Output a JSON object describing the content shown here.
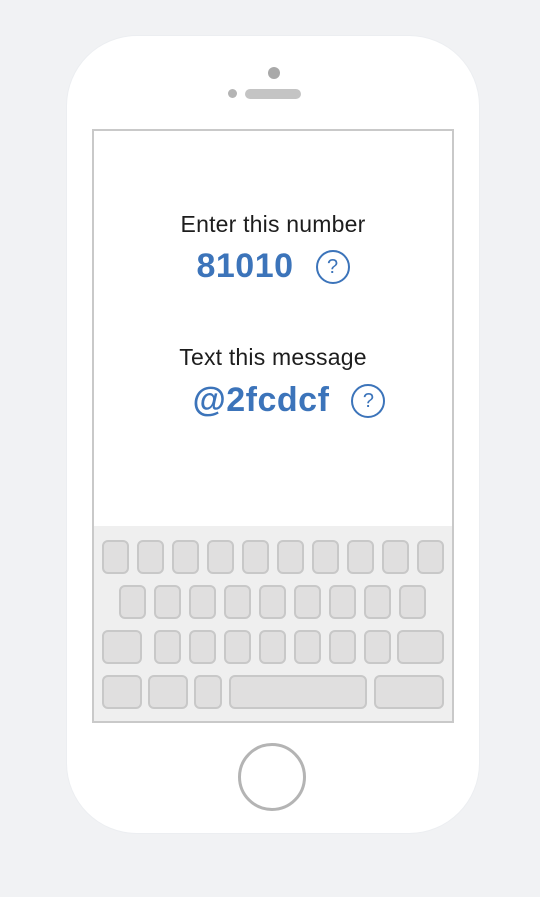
{
  "number_prompt": {
    "label": "Enter this number",
    "value": "81010",
    "help_icon": "?"
  },
  "message_prompt": {
    "label": "Text this message",
    "value": "@2fcdcf",
    "help_icon": "?"
  },
  "colors": {
    "accent": "#3c74ba",
    "background": "#f1f2f4",
    "phone_body": "#ffffff",
    "key_fill": "#e0dfdf"
  }
}
